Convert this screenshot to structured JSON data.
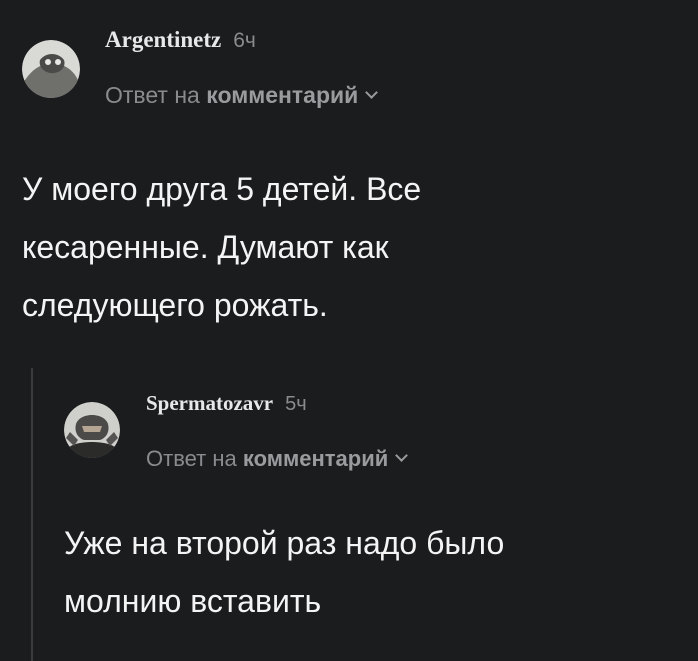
{
  "comments": [
    {
      "author": "Argentinetz",
      "time": "6ч",
      "reply_prefix": "Ответ на",
      "reply_target": "комментарий",
      "text": "У моего друга 5 детей. Все\nкесаренные. Думают как\nследующего рожать."
    },
    {
      "author": "Spermatozavr",
      "time": "5ч",
      "reply_prefix": "Ответ на",
      "reply_target": "комментарий",
      "text": "Уже на второй раз надо было\nмолнию вставить"
    }
  ]
}
